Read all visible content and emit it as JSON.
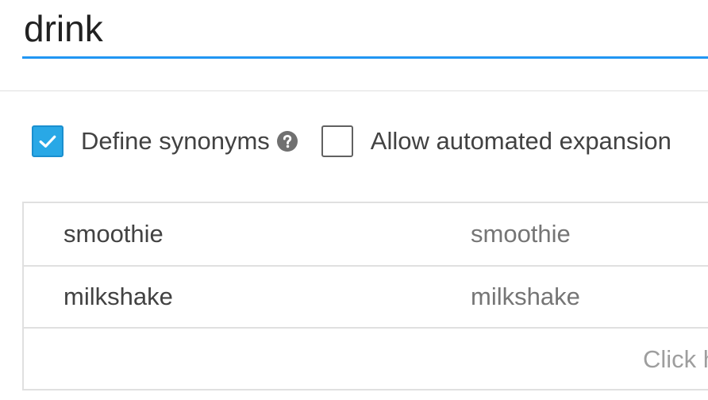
{
  "entity": {
    "name": "drink"
  },
  "options": {
    "define_synonyms": {
      "label": "Define synonyms",
      "checked": true,
      "help_icon": "question-circle-icon"
    },
    "automated_expansion": {
      "label": "Allow automated expansion",
      "checked": false
    }
  },
  "table": {
    "rows": [
      {
        "reference": "smoothie",
        "synonyms": "smoothie"
      },
      {
        "reference": "milkshake",
        "synonyms": "milkshake"
      }
    ],
    "add_row_hint": "Click h"
  },
  "colors": {
    "accent": "#2196f3",
    "checkbox_checked": "#29a8e6"
  }
}
